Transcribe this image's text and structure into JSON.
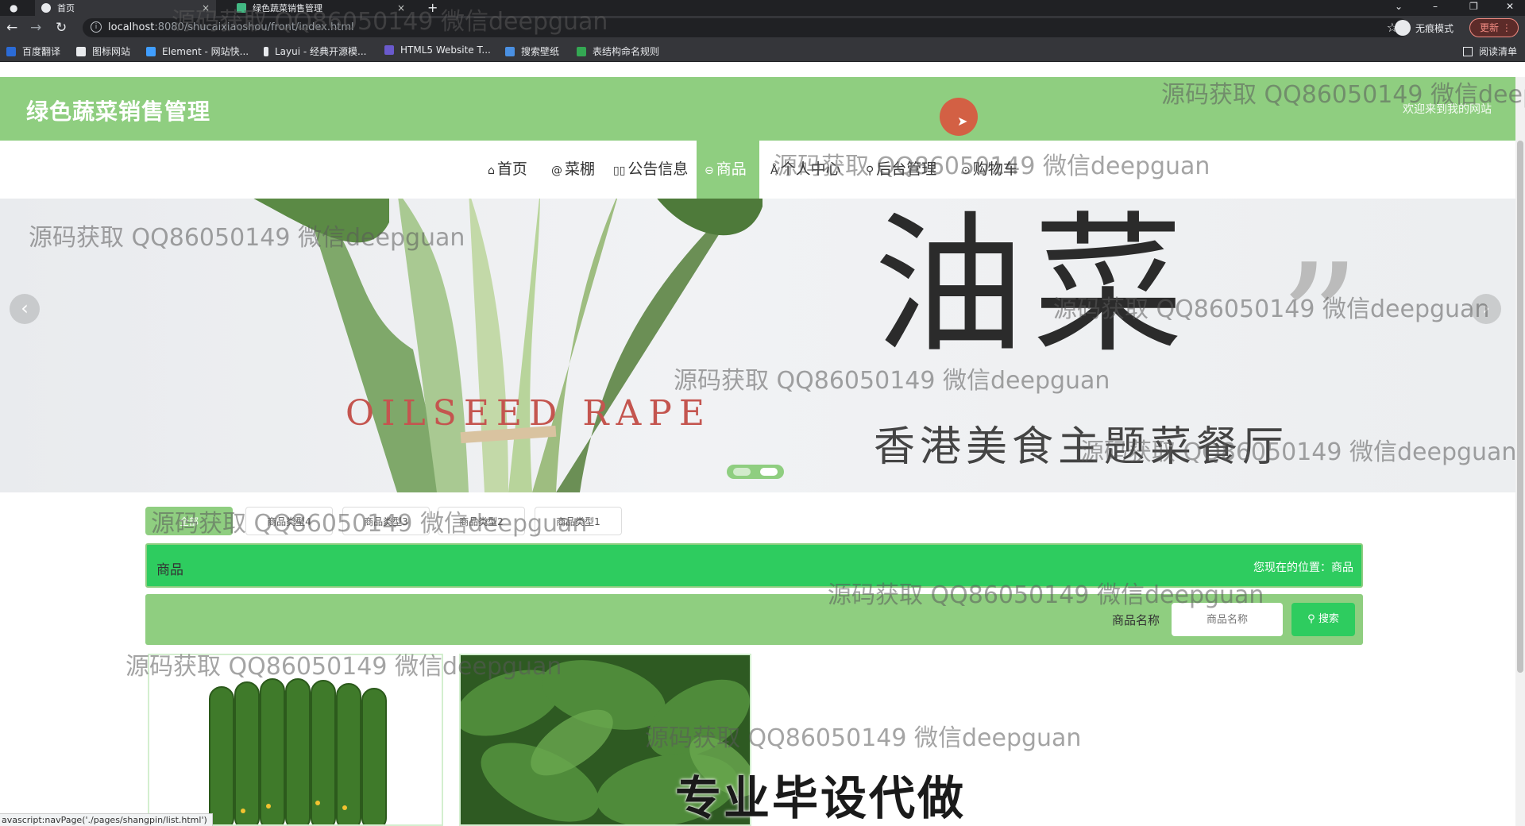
{
  "browser": {
    "tabs": [
      {
        "title": "首页"
      },
      {
        "title": "绿色蔬菜销售管理"
      }
    ],
    "url_host": "localhost",
    "url_path": ":8080/shucaixiaoshou/front/index.html",
    "incognito_label": "无痕模式",
    "update_label": "更新",
    "bookmarks": [
      "百度翻译",
      "图标网站",
      "Element - 网站快...",
      "Layui - 经典开源模...",
      "HTML5 Website T...",
      "搜索壁纸",
      "表结构命名规则"
    ],
    "reading_list": "阅读清单",
    "status_link": "avascript:navPage('./pages/shangpin/list.html')"
  },
  "header": {
    "title": "绿色蔬菜销售管理",
    "welcome": "欢迎来到我的网站"
  },
  "nav": {
    "items": [
      {
        "icon": "⌂",
        "label": "首页"
      },
      {
        "icon": "@",
        "label": "菜棚"
      },
      {
        "icon": "▯▯",
        "label": "公告信息"
      },
      {
        "icon": "⊖",
        "label": "商品"
      },
      {
        "icon": "Å",
        "label": "个人中心"
      },
      {
        "icon": "⚲",
        "label": "后台管理"
      },
      {
        "icon": "⊙",
        "label": "购物车"
      }
    ],
    "active_index": 3
  },
  "carousel": {
    "big_text": "油菜",
    "english_text": "OILSEED RAPE",
    "sub_text": "香港美食主题菜餐厅",
    "prev": "‹",
    "next": "›"
  },
  "categories": [
    "全部",
    "商品类型4",
    "商品类型3",
    "商品类型2",
    "商品类型1"
  ],
  "section": {
    "title": "商品",
    "breadcrumb": "您现在的位置：商品"
  },
  "search": {
    "label": "商品名称",
    "placeholder": "商品名称",
    "button": "搜索"
  },
  "overlays": {
    "watermark": "源码获取 QQ86050149 微信deepguan",
    "promo": "专业毕设代做"
  },
  "colors": {
    "header_green": "#8fce80",
    "section_green": "#2ecc5f"
  }
}
